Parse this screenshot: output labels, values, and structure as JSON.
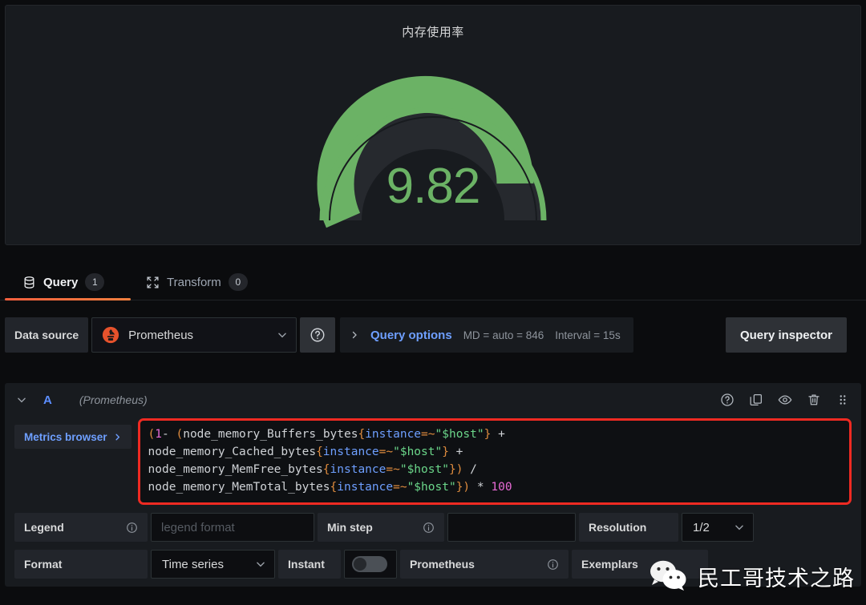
{
  "panel": {
    "title": "内存使用率",
    "gauge": {
      "value": "9.82",
      "value_color": "#6bb265",
      "track_color": "#26292e",
      "min": 0,
      "max": 100,
      "percent": 9.82
    }
  },
  "tabs": [
    {
      "label": "Query",
      "badge": "1",
      "icon": "database-icon",
      "active": true
    },
    {
      "label": "Transform",
      "badge": "0",
      "icon": "transform-icon",
      "active": false
    }
  ],
  "datasource_row": {
    "label": "Data source",
    "selected": "Prometheus",
    "icon": "prometheus-icon",
    "help_icon": "help-circle-icon",
    "query_options": {
      "title": "Query options",
      "max_data_points": "MD = auto = 846",
      "interval": "Interval = 15s"
    },
    "query_inspector": "Query inspector"
  },
  "query_row": {
    "ref_id": "A",
    "datasource": "(Prometheus)",
    "actions": [
      {
        "name": "help-circle-icon"
      },
      {
        "name": "duplicate-icon"
      },
      {
        "name": "eye-icon"
      },
      {
        "name": "trash-icon"
      },
      {
        "name": "drag-handle-icon"
      }
    ],
    "metrics_browser": "Metrics browser",
    "expression": "(1- (node_memory_Buffers_bytes{instance=~\"$host\"} + node_memory_Cached_bytes{instance=~\"$host\"} + node_memory_MemFree_bytes{instance=~\"$host\"}) / node_memory_MemTotal_bytes{instance=~\"$host\"}) * 100",
    "highlight_color": "#ee2a22"
  },
  "options": {
    "legend_label": "Legend",
    "legend_placeholder": "legend format",
    "legend_value": "",
    "min_step_label": "Min step",
    "min_step_value": "",
    "resolution_label": "Resolution",
    "resolution_value": "1/2",
    "format_label": "Format",
    "format_value": "Time series",
    "instant_label": "Instant",
    "instant_on": false,
    "prometheus_label": "Prometheus",
    "exemplars_label": "Exemplars"
  },
  "watermark": {
    "text": "民工哥技术之路",
    "icon": "wechat-icon"
  }
}
